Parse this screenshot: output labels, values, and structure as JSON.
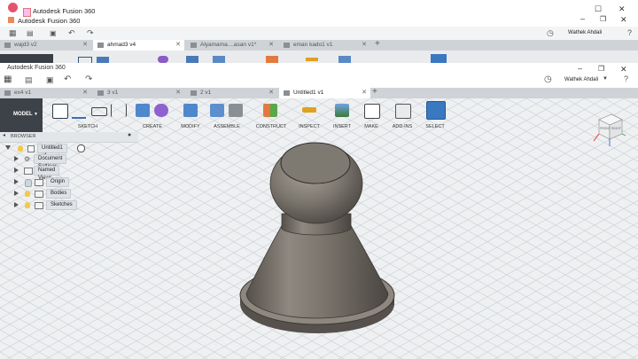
{
  "outer_window": {
    "app_title": "Autodesk Fusion 360",
    "subtitle": "Autodesk Fusion 360",
    "user": "Wathek Ahdali",
    "tabs": [
      {
        "label": "wajd3 v2",
        "active": false
      },
      {
        "label": "ahmad3 v4",
        "active": true
      },
      {
        "label": "Alyamama....asan v1*",
        "active": false
      },
      {
        "label": "eman kado1 v1",
        "active": false
      }
    ]
  },
  "inner_window": {
    "app_title": "Autodesk Fusion 360",
    "user": "Wathek Ahdali",
    "tabs": [
      {
        "label": "ex4 v1",
        "active": false
      },
      {
        "label": "3 v1",
        "active": false
      },
      {
        "label": "2 v1",
        "active": false
      },
      {
        "label": "Untitled1 v1",
        "active": true
      }
    ]
  },
  "ribbon": {
    "workspace": "MODEL",
    "groups": [
      "SKETCH",
      "CREATE",
      "MODIFY",
      "ASSEMBLE",
      "CONSTRUCT",
      "INSPECT",
      "INSERT",
      "MAKE",
      "ADD-INS",
      "SELECT"
    ]
  },
  "browser": {
    "title": "BROWSER",
    "root": "Untitled1 v1",
    "items": [
      "Document Settings",
      "Named Views",
      "Origin",
      "Bodies",
      "Sketches"
    ]
  },
  "viewcube": {
    "face": "FRONT",
    "side": "RIGHT"
  }
}
